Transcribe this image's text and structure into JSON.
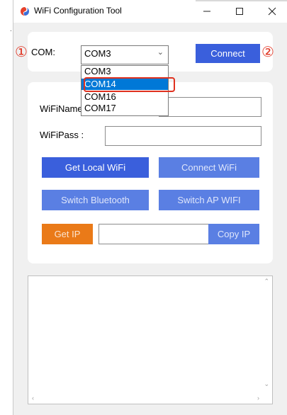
{
  "window": {
    "title": "WiFi Configuration Tool"
  },
  "annotations": {
    "marker_1": "①",
    "marker_2": "②"
  },
  "com": {
    "label": "COM:",
    "selected": "COM3",
    "options": [
      "COM3",
      "COM14",
      "COM16",
      "COM17"
    ],
    "highlighted_option": "COM14",
    "connect_label": "Connect"
  },
  "wifi": {
    "name_label": "WiFiName:",
    "name_value": "",
    "pass_label": "WiFiPass :",
    "pass_value": ""
  },
  "buttons": {
    "get_local_wifi": "Get Local WiFi",
    "connect_wifi": "Connect WiFi",
    "switch_bluetooth": "Switch Bluetooth",
    "switch_ap_wifi": "Switch AP WIFI",
    "get_ip": "Get IP",
    "copy_ip": "Copy IP"
  },
  "ip_value": "",
  "log_text": "",
  "colors": {
    "accent": "#3a5fdc",
    "accent_light": "#5a7fe3",
    "orange": "#ea7a18",
    "highlight": "#e0311f",
    "select_blue": "#0078d7"
  },
  "icons": [
    "app-logo-icon",
    "minimize-icon",
    "maximize-icon",
    "close-icon",
    "chevron-down-icon",
    "scroll-up-icon",
    "scroll-down-icon",
    "scroll-left-icon",
    "scroll-right-icon"
  ]
}
